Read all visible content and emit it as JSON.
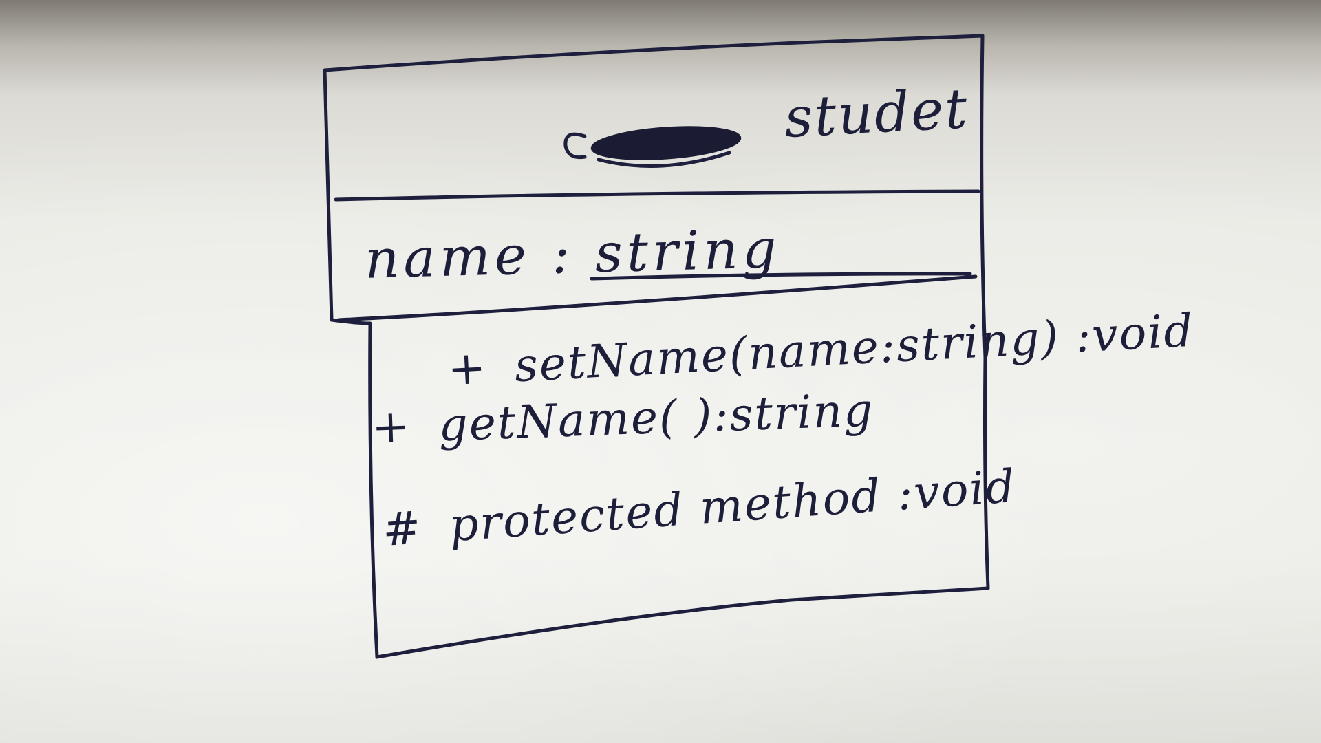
{
  "class_box": {
    "name": "studet"
  },
  "attributes": [
    {
      "text": "name : string"
    }
  ],
  "methods": [
    {
      "visibility": "+",
      "signature": "setName(name:string) :void"
    },
    {
      "visibility": "+",
      "signature": "getName( ):string"
    },
    {
      "visibility": "#",
      "signature": "protected method :void"
    }
  ],
  "colors": {
    "ink": "#1d1f3d",
    "paper": "#ebebe6"
  }
}
